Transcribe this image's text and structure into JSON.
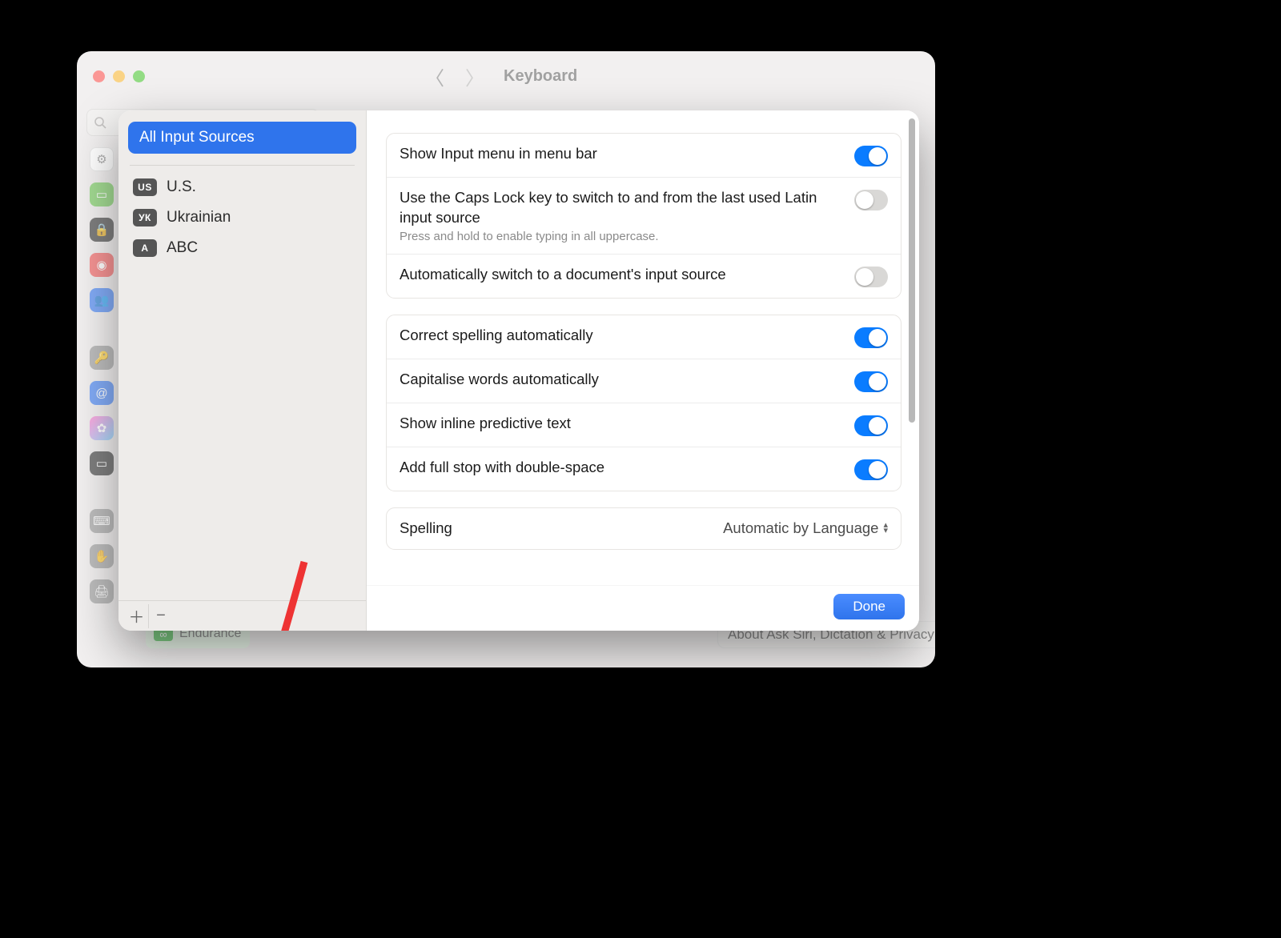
{
  "window": {
    "title": "Keyboard"
  },
  "bottom_sidebar_item": {
    "label": "Endurance",
    "icon": "∞"
  },
  "about_button": "About Ask Siri, Dictation & Privacy…",
  "sidebar": {
    "header": "All Input Sources",
    "sources": [
      {
        "badge": "US",
        "label": "U.S."
      },
      {
        "badge": "УК",
        "label": "Ukrainian"
      },
      {
        "badge": "A",
        "label": "ABC"
      }
    ]
  },
  "settings": {
    "group1": [
      {
        "title": "Show Input menu in menu bar",
        "sub": "",
        "on": true
      },
      {
        "title": "Use the Caps Lock key to switch to and from the last used Latin input source",
        "sub": "Press and hold to enable typing in all uppercase.",
        "on": false
      },
      {
        "title": "Automatically switch to a document's input source",
        "sub": "",
        "on": false
      }
    ],
    "group2": [
      {
        "title": "Correct spelling automatically",
        "on": true
      },
      {
        "title": "Capitalise words automatically",
        "on": true
      },
      {
        "title": "Show inline predictive text",
        "on": true
      },
      {
        "title": "Add full stop with double-space",
        "on": true
      }
    ],
    "spelling": {
      "label": "Spelling",
      "value": "Automatic by Language"
    }
  },
  "buttons": {
    "done": "Done"
  }
}
